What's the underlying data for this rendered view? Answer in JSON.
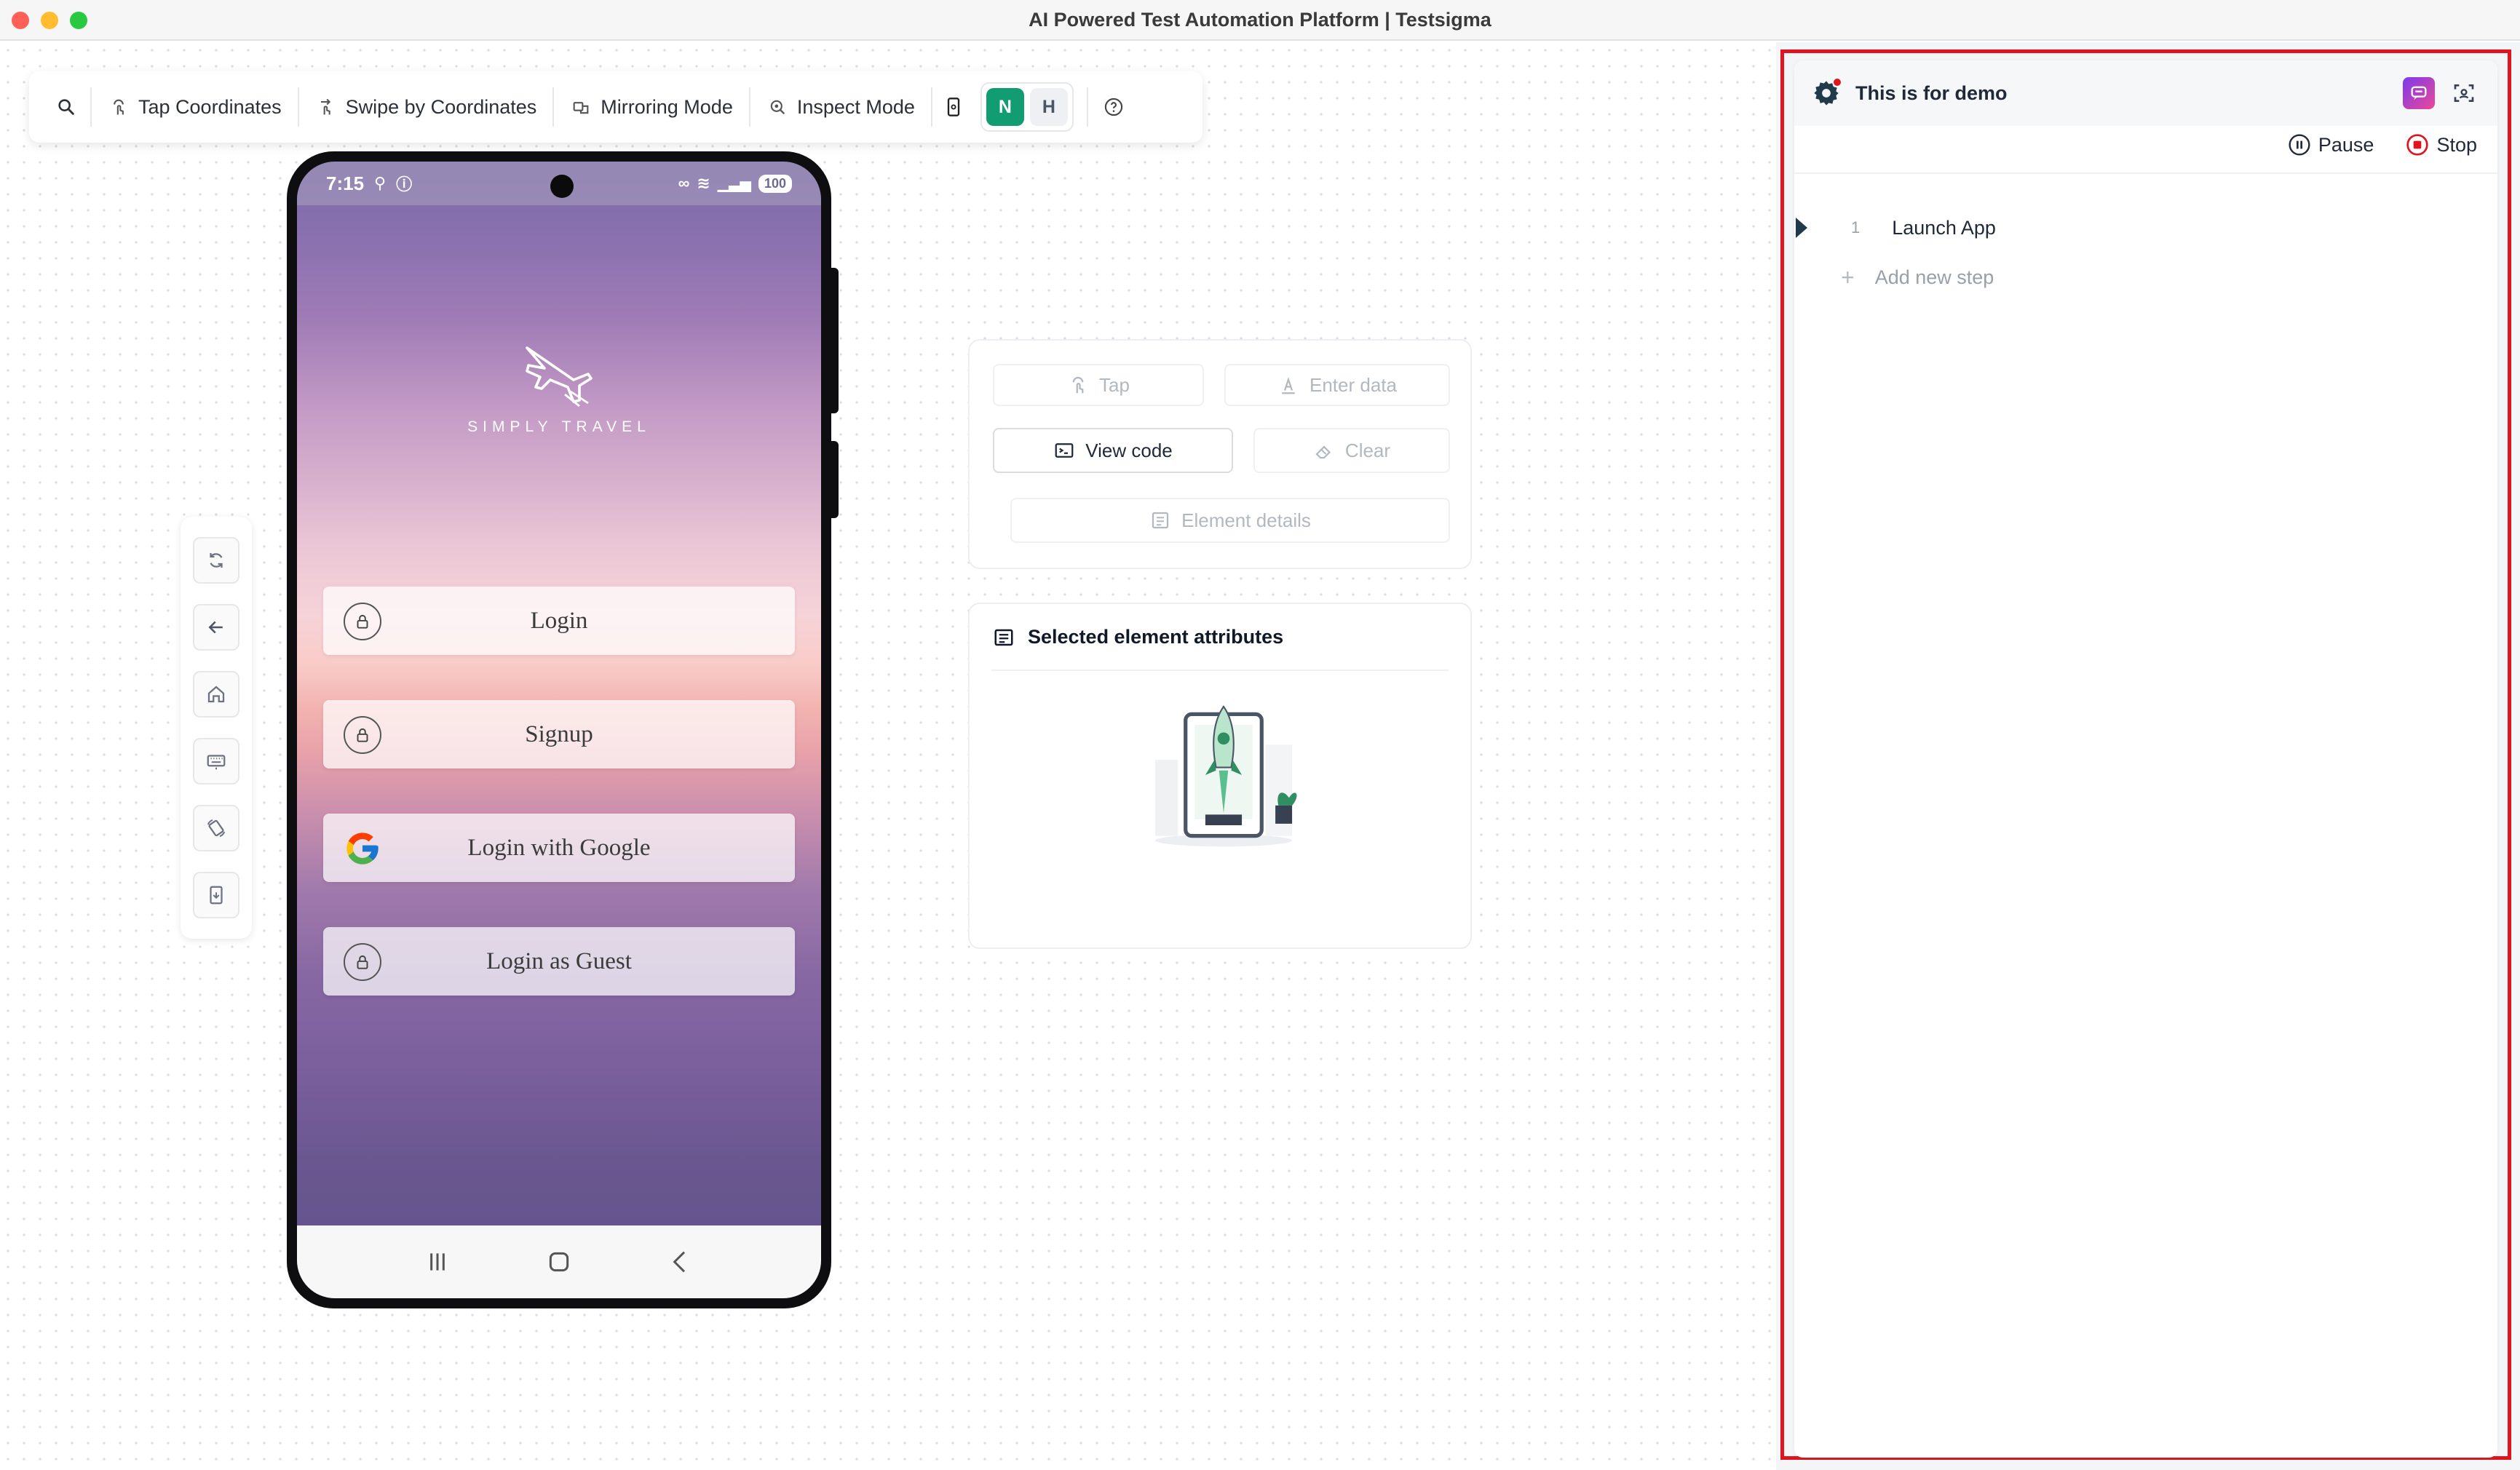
{
  "window": {
    "title": "AI Powered Test Automation Platform | Testsigma"
  },
  "toolbar": {
    "tap_coordinates": "Tap Coordinates",
    "swipe_by_coordinates": "Swipe by Coordinates",
    "mirroring_mode": "Mirroring Mode",
    "inspect_mode": "Inspect Mode",
    "toggle_n": "N",
    "toggle_h": "H",
    "active_toggle": "N",
    "accent": "#129c71"
  },
  "side_controls": [
    "refresh-icon",
    "back-arrow-icon",
    "home-icon",
    "keyboard-icon",
    "rotate-icon",
    "install-app-icon"
  ],
  "phone": {
    "status_time": "7:15",
    "battery": "100",
    "app_logo_text": "SIMPLY TRAVEL",
    "buttons": [
      {
        "label": "Login",
        "icon": "lock-icon"
      },
      {
        "label": "Signup",
        "icon": "lock-icon"
      },
      {
        "label": "Login with Google",
        "icon": "google-icon"
      },
      {
        "label": "Login as Guest",
        "icon": "lock-icon"
      }
    ]
  },
  "actions": {
    "tap": "Tap",
    "enter_data": "Enter data",
    "view_code": "View code",
    "clear": "Clear",
    "element_details": "Element details"
  },
  "attributes": {
    "title": "Selected element attributes"
  },
  "recorder": {
    "title": "This is for demo",
    "pause": "Pause",
    "stop": "Stop",
    "steps": [
      {
        "number": "1",
        "label": "Launch App"
      }
    ],
    "add_step": "Add new step",
    "highlight_color": "#e0141e"
  }
}
